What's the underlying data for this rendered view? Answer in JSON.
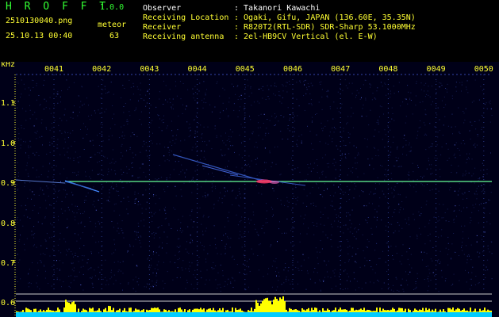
{
  "header": {
    "app_name": "H R O F F T",
    "version": "1.0.0",
    "filename": "2510130040.png",
    "meteor_label": "meteor",
    "meteor_count": "63",
    "datetime": "25.10.13 00:40",
    "info": [
      {
        "label": "Observer",
        "value": ": Takanori Kawachi"
      },
      {
        "label": "Receiving Location",
        "value": ": Ogaki, Gifu, JAPAN (136.60E, 35.35N)"
      },
      {
        "label": "Receiver",
        "value": ": R820T2(RTL-SDR) SDR-Sharp 53.1000MHz"
      },
      {
        "label": "Receiving antenna",
        "value": ": 2el-HB9CV Vertical (el. E-W)"
      }
    ]
  },
  "spectrogram": {
    "y_unit": "kHz",
    "y_ticks": [
      "1.1",
      "1.0",
      "0.9",
      "0.8",
      "0.7",
      "0.6"
    ],
    "time_ticks": [
      "0041",
      "0042",
      "0043",
      "0044",
      "0045",
      "0046",
      "0047",
      "0048",
      "0049",
      "0050"
    ],
    "colors": {
      "background": "#000018",
      "carrier": "#66ff99",
      "echo": "#ff3366",
      "level": "#ffff00",
      "noise_floor": "#00ccff"
    }
  }
}
